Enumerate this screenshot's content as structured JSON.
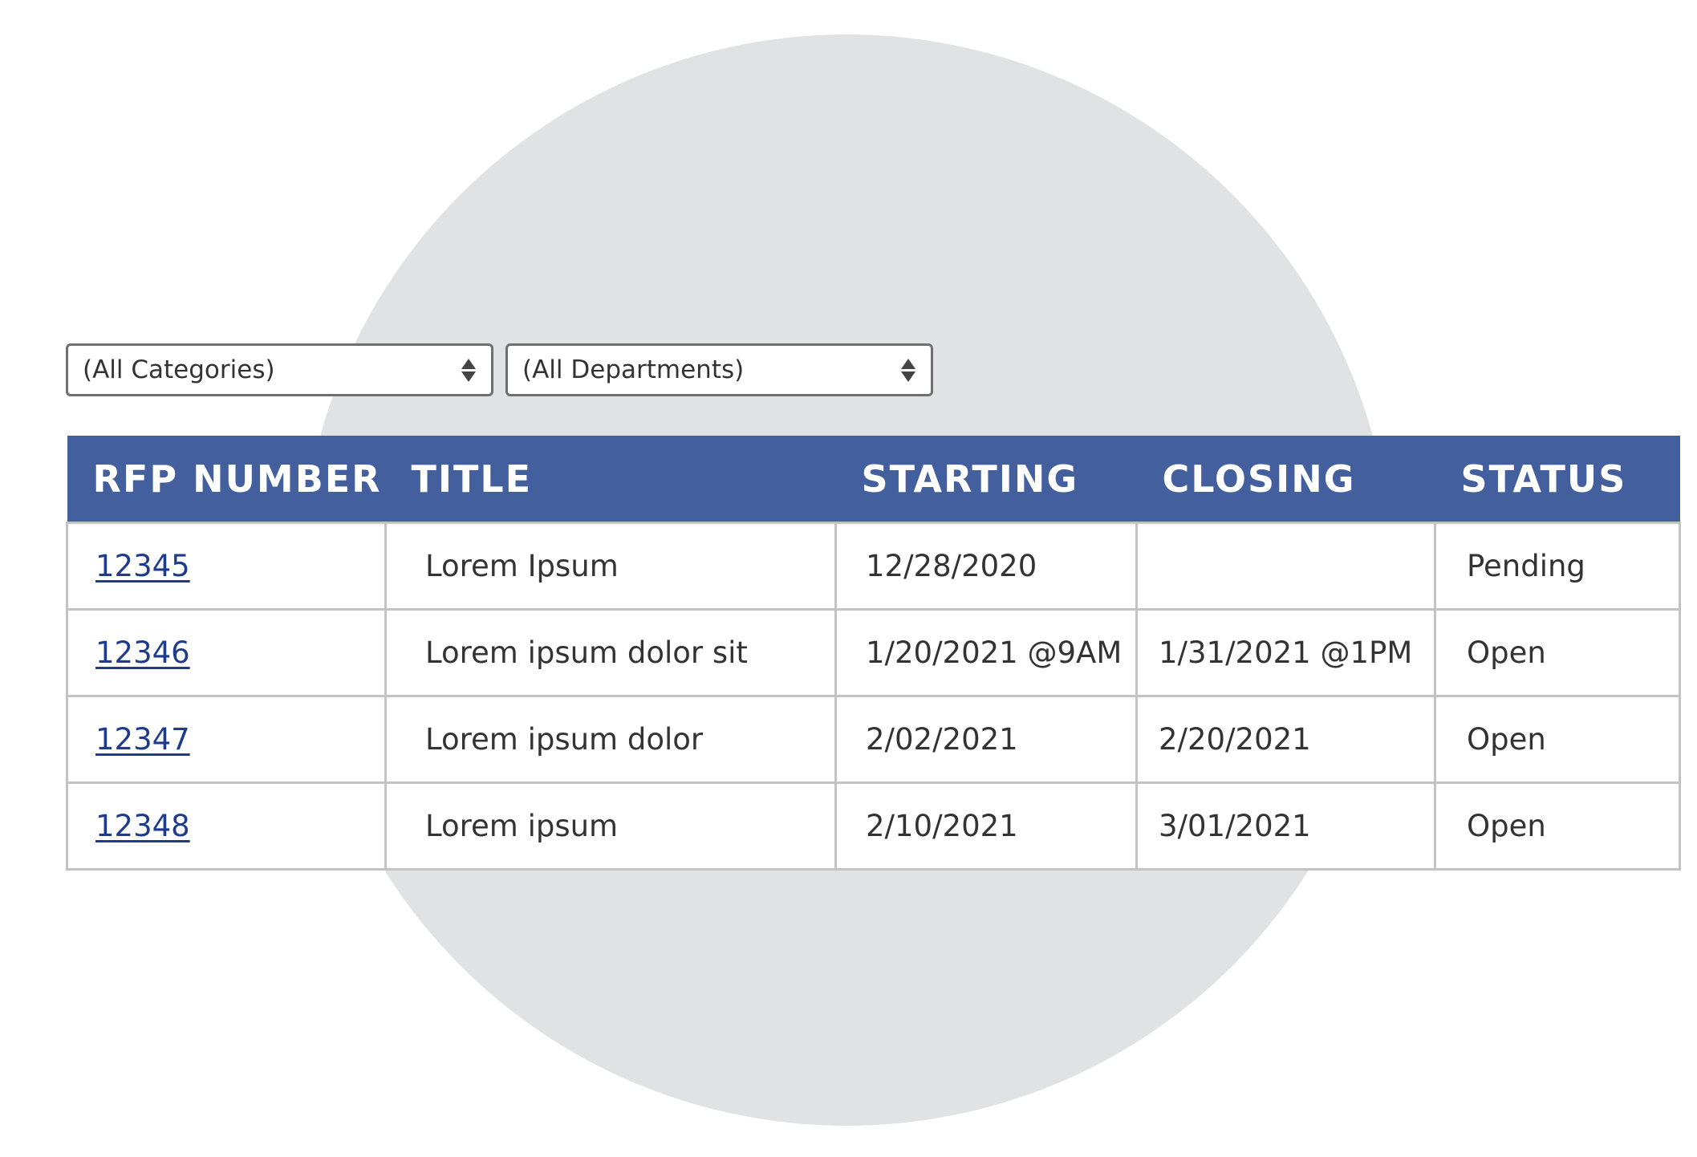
{
  "filters": {
    "category": "(All Categories)",
    "department": "(All Departments)"
  },
  "table": {
    "headers": [
      "RFP NUMBER",
      "TITLE",
      "STARTING",
      "CLOSING",
      "STATUS"
    ],
    "rows": [
      {
        "number": "12345",
        "title": "Lorem Ipsum",
        "starting": "12/28/2020",
        "closing": "",
        "status": "Pending"
      },
      {
        "number": "12346",
        "title": "Lorem ipsum dolor sit",
        "starting": "1/20/2021 @9AM",
        "closing": "1/31/2021 @1PM",
        "status": "Open"
      },
      {
        "number": "12347",
        "title": "Lorem ipsum dolor",
        "starting": "2/02/2021",
        "closing": "2/20/2021",
        "status": "Open"
      },
      {
        "number": "12348",
        "title": "Lorem ipsum",
        "starting": "2/10/2021",
        "closing": "3/01/2021",
        "status": "Open"
      }
    ]
  },
  "colors": {
    "header_bg": "#445f9e",
    "header_text": "#ffffff",
    "link": "#1f3b8e",
    "background_circle": "#e1e2e4",
    "border": "#c3c3c3"
  },
  "icons": {
    "select_arrows": "up-down-triangles-icon"
  }
}
